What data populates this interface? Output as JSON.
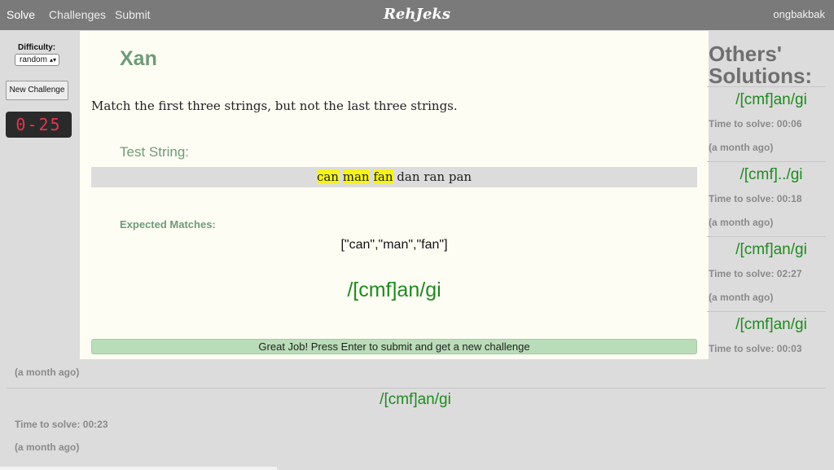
{
  "nav": {
    "links": [
      "Solve",
      "Challenges",
      "Submit"
    ],
    "brand": "RehJeks",
    "user": "ongbakbak"
  },
  "sidebar": {
    "difficulty_label": "Difficulty:",
    "difficulty_value": "random",
    "new_challenge": "New Challenge",
    "timer": "0-25",
    "timer_color": "#e0384a"
  },
  "challenge": {
    "title": "Xan",
    "instruction": "Match the first three strings, but not the last three strings.",
    "test_string_label": "Test String:",
    "test_words": [
      {
        "text": "can",
        "matched": true
      },
      {
        "text": "man",
        "matched": true
      },
      {
        "text": "fan",
        "matched": true
      },
      {
        "text": "dan",
        "matched": false
      },
      {
        "text": "ran",
        "matched": false
      },
      {
        "text": "pan",
        "matched": false
      }
    ],
    "expected_label": "Expected Matches:",
    "expected_matches": "[\"can\",\"man\",\"fan\"]",
    "answer": "/[cmf]an/gi",
    "success_message": "Great Job! Press Enter to submit and get a new challenge"
  },
  "others": {
    "title_line1": "Others'",
    "title_line2": "Solutions:",
    "solutions": [
      {
        "regex": "/[cmf]an/gi",
        "time": "Time to solve: 00:06",
        "ago": "(a month ago)"
      },
      {
        "regex": "/[cmf]../gi",
        "time": "Time to solve: 00:18",
        "ago": "(a month ago)"
      },
      {
        "regex": "/[cmf]an/gi",
        "time": "Time to solve: 02:27",
        "ago": "(a month ago)"
      },
      {
        "regex": "/[cmf]an/gi",
        "time": "Time to solve: 00:03",
        "ago": "(a month ago)"
      },
      {
        "regex": "/[cmf]an/gi",
        "time": "Time to solve: 00:23",
        "ago": "(a month ago)"
      }
    ]
  },
  "colors": {
    "accent_green": "#6f9b78",
    "regex_green": "#1f8a1f",
    "highlight": "#f6f31c",
    "success_bg": "#b9dcb9"
  }
}
